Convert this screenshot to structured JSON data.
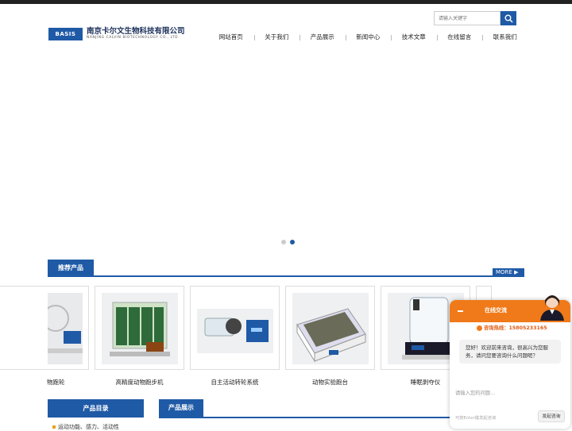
{
  "brand": {
    "badge": "BASIS",
    "name_cn": "南京卡尔文生物科技有限公司",
    "name_en": "NANJING CALVIN BIOTECHNOLOGY CO., LTD"
  },
  "search": {
    "placeholder": "请输入关键字"
  },
  "nav": [
    "网站首页",
    "关于我们",
    "产品展示",
    "新闻中心",
    "技术文章",
    "在线留言",
    "联系我们"
  ],
  "recommended": {
    "title": "推荐产品",
    "more": "MORE",
    "products": [
      "物跑轮",
      "高精度动物跑步机",
      "自主活动转轮系统",
      "动物实验跑台",
      "睡眠剥夺仪"
    ]
  },
  "category": {
    "title": "产品目录",
    "first_item": "运动功能、感力、活动性"
  },
  "product_show": {
    "title": "产品展示"
  },
  "chat": {
    "title": "在线交流",
    "hotline": "咨询热线：15805233165",
    "greeting": "您好！欢迎前来咨询，很高兴为您服务，请问您要咨询什么问题呢？",
    "input_placeholder": "请输入您的问题...",
    "hint": "可按Enter键发起咨询",
    "send": "发起咨询"
  },
  "colors": {
    "accent": "#1f5aa6",
    "chat": "#f07a1a"
  }
}
